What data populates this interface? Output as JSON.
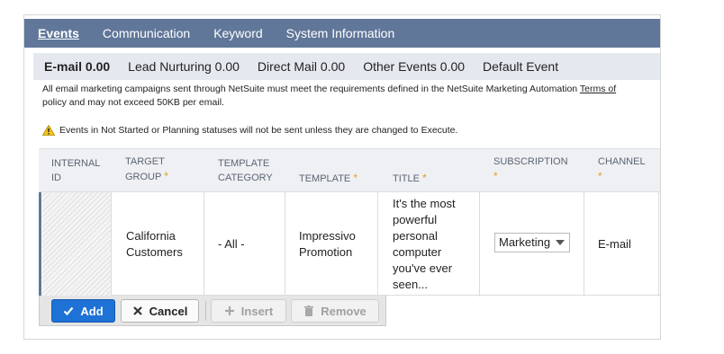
{
  "tabs": [
    {
      "label": "Events",
      "active": true
    },
    {
      "label": "Communication",
      "active": false
    },
    {
      "label": "Keyword",
      "active": false
    },
    {
      "label": "System Information",
      "active": false
    }
  ],
  "subtabs": [
    {
      "label": "E-mail 0.00",
      "active": true
    },
    {
      "label": "Lead Nurturing 0.00",
      "active": false
    },
    {
      "label": "Direct Mail 0.00",
      "active": false
    },
    {
      "label": "Other Events 0.00",
      "active": false
    },
    {
      "label": "Default Event",
      "active": false
    }
  ],
  "notice": {
    "text": "All email marketing campaigns sent through NetSuite must meet the requirements defined in the NetSuite Marketing Automation ",
    "link": "Terms of",
    "text2": "policy and may not exceed 50KB per email."
  },
  "warning": "Events in Not Started or Planning statuses will not be sent unless they are changed to Execute.",
  "columns": {
    "internal_id_1": "INTERNAL",
    "internal_id_2": "ID",
    "target_group_1": "TARGET",
    "target_group_2": "GROUP",
    "template_category_1": "TEMPLATE",
    "template_category_2": "CATEGORY",
    "template": "TEMPLATE",
    "title": "TITLE",
    "subscription": "SUBSCRIPTION",
    "channel": "CHANNEL",
    "required_mark": "*"
  },
  "row": {
    "target_group_1": "California",
    "target_group_2": "Customers",
    "template_category": "- All -",
    "template_1": "Impressivo",
    "template_2": "Promotion",
    "title_lines": [
      "It's the most",
      "powerful",
      "personal",
      "computer",
      "you've ever",
      "seen..."
    ],
    "subscription": "Marketing",
    "channel": "E-mail"
  },
  "buttons": {
    "add": "Add",
    "cancel": "Cancel",
    "insert": "Insert",
    "remove": "Remove"
  },
  "colors": {
    "tabbar": "#607799",
    "primary_button": "#1e72d6",
    "required": "#e3a21a"
  }
}
